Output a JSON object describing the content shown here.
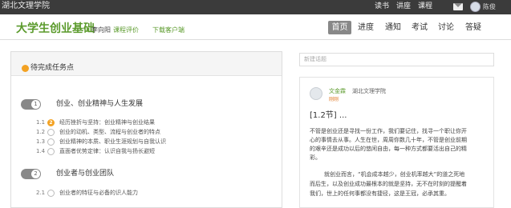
{
  "topbar": {
    "brand": "湖北文理学院",
    "links": [
      "读书",
      "讲座",
      "课程"
    ],
    "username": "陈俊"
  },
  "course": {
    "title": "大学生创业基础",
    "teacher": "李向阳",
    "eval_label": "课程评价",
    "download_label": "下载客户端"
  },
  "nav": {
    "items": [
      "首页",
      "进度",
      "通知",
      "考试",
      "讨论",
      "答疑"
    ],
    "active": "首页"
  },
  "tasks": {
    "title": "待完成任务点",
    "chapters": [
      {
        "number": "1",
        "title": "创业、创业精神与人生发展",
        "lessons": [
          {
            "num": "1.1",
            "title": "经历挫折与坚持：创业精神与创业结果",
            "alert": "2"
          },
          {
            "num": "1.2",
            "title": "创业的动机、类型、流程与创业者的特点",
            "alert": ""
          },
          {
            "num": "1.3",
            "title": "创业精神的本质、职业生涯规划与自我认识",
            "alert": ""
          },
          {
            "num": "1.4",
            "title": "直面者优势定律：认识自我与扬长避短",
            "alert": ""
          }
        ]
      },
      {
        "number": "2",
        "title": "创业者与创业团队",
        "lessons": [
          {
            "num": "2.1",
            "title": "创业者的特征与必备的识人能力",
            "alert": ""
          }
        ]
      }
    ]
  },
  "discussion": {
    "search_placeholder": "新建话题",
    "post": {
      "author": "文金霖",
      "school": "湖北文理学院",
      "tag": "刚刚",
      "heading": "[1.2节] ...",
      "lines": [
        "不管是创业还是寻找一份工作，我们要记住，找寻一个职让你开",
        "心的事情去从事。人生在世，周周你数几十年，不管是创业前期",
        "的艰辛还是成功以后的悠闲自由，每一种方式都要活出自己的精",
        "彩。",
        "",
        "就创业而言，“机会成本越少，创业机率越大”的道之死地",
        "而后生，以及创业成功最根本的就是坚持，无不在时刻的提醒着",
        "我们，世上的任何事都没有捷径，这是王冠，必承其重。"
      ]
    }
  }
}
